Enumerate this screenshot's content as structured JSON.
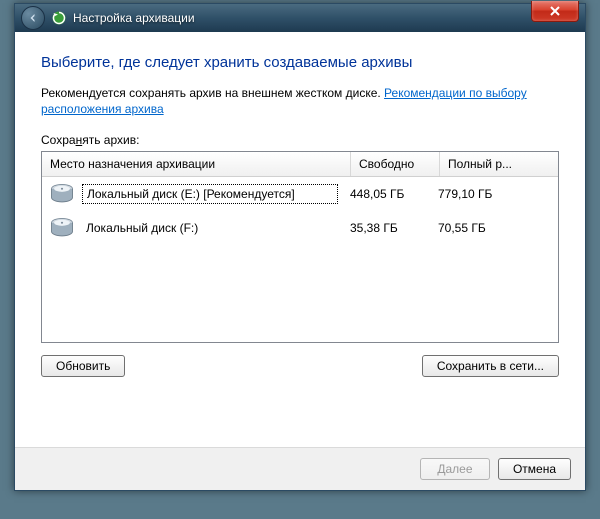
{
  "window": {
    "title": "Настройка архивации"
  },
  "heading": "Выберите, где следует хранить создаваемые архивы",
  "subtext_prefix": "Рекомендуется сохранять архив на внешнем жестком диске. ",
  "subtext_link": "Рекомендации по выбору расположения архива",
  "save_label_prefix": "Сохра",
  "save_label_underlined": "н",
  "save_label_suffix": "ять архив:",
  "columns": {
    "dest": "Место назначения архивации",
    "free": "Свободно",
    "total": "Полный р..."
  },
  "rows": [
    {
      "label": "Локальный диск (E:) [Рекомендуется]",
      "free": "448,05 ГБ",
      "total": "779,10 ГБ",
      "selected": true
    },
    {
      "label": "Локальный диск (F:)",
      "free": "35,38 ГБ",
      "total": "70,55 ГБ",
      "selected": false
    }
  ],
  "buttons": {
    "refresh": "Обновить",
    "save_network": "Сохранить в сети...",
    "next": "Далее",
    "cancel": "Отмена"
  }
}
